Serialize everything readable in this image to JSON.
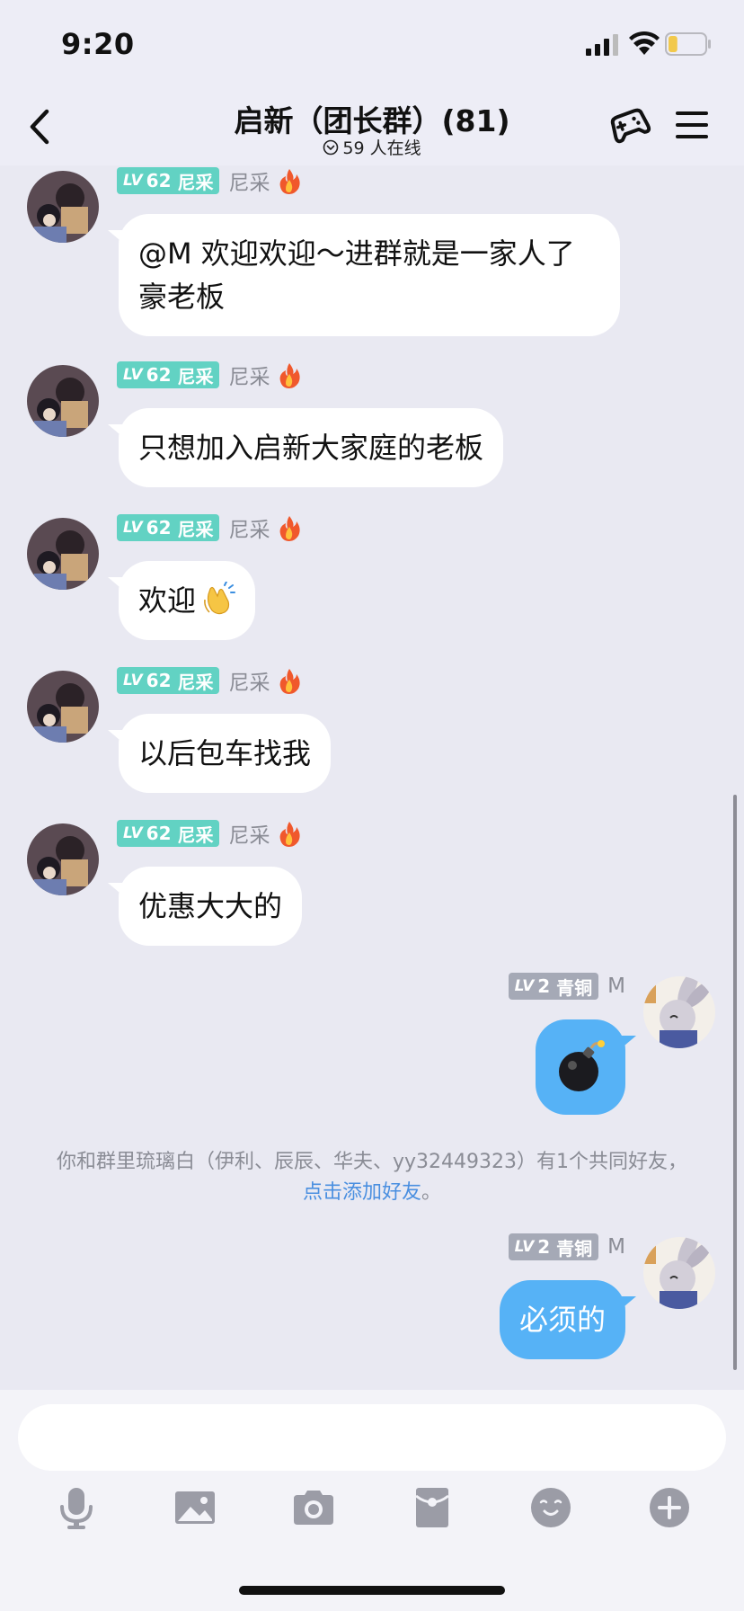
{
  "status_bar": {
    "time": "9:20",
    "battery_level": 0.25
  },
  "header": {
    "title": "启新（团长群）(81)",
    "online": "59 人在线"
  },
  "messages": [
    {
      "sender": "尼采",
      "level_prefix": "LV",
      "level": "62",
      "rank": "尼采",
      "text": "@M 欢迎欢迎～进群就是一家人了豪老板"
    },
    {
      "sender": "尼采",
      "level_prefix": "LV",
      "level": "62",
      "rank": "尼采",
      "text": "只想加入启新大家庭的老板"
    },
    {
      "sender": "尼采",
      "level_prefix": "LV",
      "level": "62",
      "rank": "尼采",
      "text": "欢迎"
    },
    {
      "sender": "尼采",
      "level_prefix": "LV",
      "level": "62",
      "rank": "尼采",
      "text": "以后包车找我"
    },
    {
      "sender": "尼采",
      "level_prefix": "LV",
      "level": "62",
      "rank": "尼采",
      "text": "优惠大大的"
    },
    {
      "sender": "M",
      "level_prefix": "LV",
      "level": "2",
      "rank": "青铜",
      "emoji": "bomb"
    },
    {
      "sender": "M",
      "level_prefix": "LV",
      "level": "2",
      "rank": "青铜",
      "text": "必须的"
    }
  ],
  "notice": {
    "text": "你和群里琉璃白（伊利、辰辰、华夫、yy32449323）有1个共同好友，",
    "link": "点击添加好友",
    "end": "。"
  },
  "colors": {
    "accent": "#56b2f6",
    "level_teal": "#62d2c3",
    "level_gray": "#a5a9b6",
    "link": "#4a8fe0"
  },
  "toolbar_icons": [
    "microphone-icon",
    "image-icon",
    "camera-icon",
    "red-packet-icon",
    "emoji-icon",
    "plus-icon"
  ]
}
